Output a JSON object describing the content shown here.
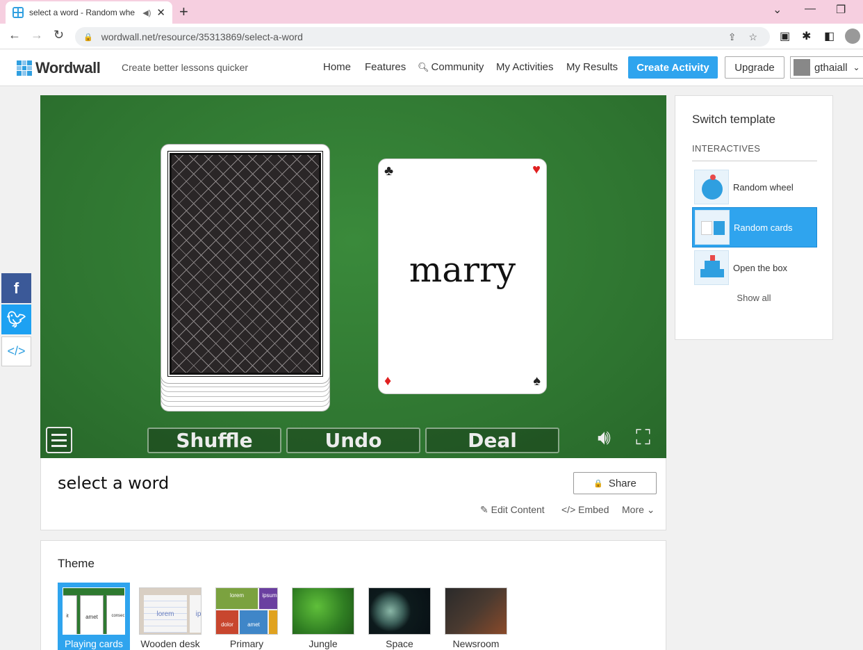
{
  "browser": {
    "tab_title": "select a word - Random whe",
    "new_tab": "+",
    "url": "wordwall.net/resource/35313869/select-a-word"
  },
  "header": {
    "logo": "Wordwall",
    "tagline": "Create better lessons quicker",
    "nav": {
      "home": "Home",
      "features": "Features",
      "community": "Community",
      "my_activities": "My Activities",
      "my_results": "My Results"
    },
    "create_label": "Create Activity",
    "upgrade_label": "Upgrade",
    "username": "gthaiall"
  },
  "game": {
    "card_word": "marry",
    "buttons": {
      "shuffle": "Shuffle",
      "undo": "Undo",
      "deal": "Deal"
    }
  },
  "activity": {
    "title": "select a word",
    "share_label": "Share",
    "edit_label": "Edit Content",
    "embed_label": "Embed",
    "more_label": "More"
  },
  "theme": {
    "heading": "Theme",
    "items": [
      {
        "label": "Playing cards",
        "selected": true
      },
      {
        "label": "Wooden desk"
      },
      {
        "label": "Primary"
      },
      {
        "label": "Jungle"
      },
      {
        "label": "Space"
      },
      {
        "label": "Newsroom"
      }
    ],
    "thumb_text": {
      "playing_cards": [
        "it",
        "amet",
        "consec"
      ],
      "wooden_desk": [
        "lorem",
        "ips"
      ],
      "primary": [
        "lorem",
        "ipsum",
        "dolor",
        "amet"
      ]
    }
  },
  "sidebar": {
    "heading": "Switch template",
    "section": "INTERACTIVES",
    "templates": [
      {
        "label": "Random wheel"
      },
      {
        "label": "Random cards",
        "selected": true
      },
      {
        "label": "Open the box"
      }
    ],
    "show_all": "Show all"
  },
  "colors": {
    "accent": "#2fa4ee",
    "table_green": "#2f7a32",
    "facebook": "#3b5998",
    "twitter": "#1da1f2"
  }
}
